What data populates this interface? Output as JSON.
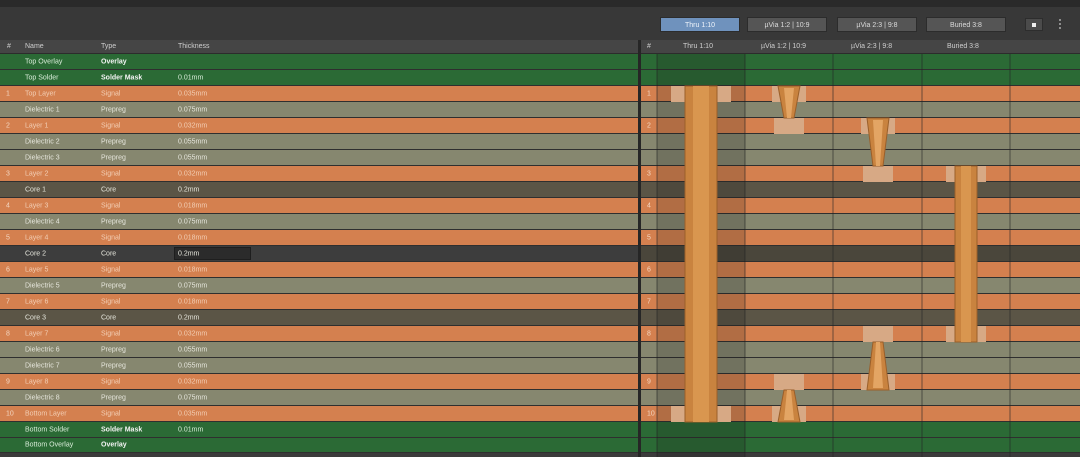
{
  "toolbar": {
    "via_tabs": [
      "Thru 1:10",
      "µVia 1:2 | 10:9",
      "µVia 2:3 | 9:8",
      "Buried 3:8"
    ],
    "active_tab": 0,
    "add_icon": "plus-icon",
    "menu_icon": "vertical-dots-icon"
  },
  "table": {
    "headers": [
      "#",
      "Name",
      "Type",
      "Thickness"
    ],
    "rows": [
      {
        "idx": "",
        "name": "Top Overlay",
        "type": "Overlay",
        "thickness": "",
        "kind": "mask"
      },
      {
        "idx": "",
        "name": "Top Solder",
        "type": "Solder Mask",
        "thickness": "0.01mm",
        "kind": "mask"
      },
      {
        "idx": "1",
        "name": "Top Layer",
        "type": "Signal",
        "thickness": "0.035mm",
        "kind": "signal"
      },
      {
        "idx": "",
        "name": "Dielectric 1",
        "type": "Prepreg",
        "thickness": "0.075mm",
        "kind": "prepreg"
      },
      {
        "idx": "2",
        "name": "Layer 1",
        "type": "Signal",
        "thickness": "0.032mm",
        "kind": "signal"
      },
      {
        "idx": "",
        "name": "Dielectric 2",
        "type": "Prepreg",
        "thickness": "0.055mm",
        "kind": "prepreg"
      },
      {
        "idx": "",
        "name": "Dielectric 3",
        "type": "Prepreg",
        "thickness": "0.055mm",
        "kind": "prepreg"
      },
      {
        "idx": "3",
        "name": "Layer 2",
        "type": "Signal",
        "thickness": "0.032mm",
        "kind": "signal"
      },
      {
        "idx": "",
        "name": "Core 1",
        "type": "Core",
        "thickness": "0.2mm",
        "kind": "core"
      },
      {
        "idx": "4",
        "name": "Layer 3",
        "type": "Signal",
        "thickness": "0.018mm",
        "kind": "signal"
      },
      {
        "idx": "",
        "name": "Dielectric 4",
        "type": "Prepreg",
        "thickness": "0.075mm",
        "kind": "prepreg"
      },
      {
        "idx": "5",
        "name": "Layer 4",
        "type": "Signal",
        "thickness": "0.018mm",
        "kind": "signal"
      },
      {
        "idx": "",
        "name": "Core 2",
        "type": "Core",
        "thickness": "0.2mm",
        "kind": "core",
        "selected": true
      },
      {
        "idx": "6",
        "name": "Layer 5",
        "type": "Signal",
        "thickness": "0.018mm",
        "kind": "signal"
      },
      {
        "idx": "",
        "name": "Dielectric 5",
        "type": "Prepreg",
        "thickness": "0.075mm",
        "kind": "prepreg"
      },
      {
        "idx": "7",
        "name": "Layer 6",
        "type": "Signal",
        "thickness": "0.018mm",
        "kind": "signal"
      },
      {
        "idx": "",
        "name": "Core 3",
        "type": "Core",
        "thickness": "0.2mm",
        "kind": "core"
      },
      {
        "idx": "8",
        "name": "Layer 7",
        "type": "Signal",
        "thickness": "0.032mm",
        "kind": "signal"
      },
      {
        "idx": "",
        "name": "Dielectric 6",
        "type": "Prepreg",
        "thickness": "0.055mm",
        "kind": "prepreg"
      },
      {
        "idx": "",
        "name": "Dielectric 7",
        "type": "Prepreg",
        "thickness": "0.055mm",
        "kind": "prepreg"
      },
      {
        "idx": "9",
        "name": "Layer 8",
        "type": "Signal",
        "thickness": "0.032mm",
        "kind": "signal"
      },
      {
        "idx": "",
        "name": "Dielectric 8",
        "type": "Prepreg",
        "thickness": "0.075mm",
        "kind": "prepreg"
      },
      {
        "idx": "10",
        "name": "Bottom Layer",
        "type": "Signal",
        "thickness": "0.035mm",
        "kind": "signal"
      },
      {
        "idx": "",
        "name": "Bottom Solder",
        "type": "Solder Mask",
        "thickness": "0.01mm",
        "kind": "mask"
      },
      {
        "idx": "",
        "name": "Bottom Overlay",
        "type": "Overlay",
        "thickness": "",
        "kind": "mask"
      }
    ]
  },
  "via_panel": {
    "headers": [
      "#",
      "Thru 1:10",
      "µVia 1:2 | 10:9",
      "µVia 2:3 | 9:8",
      "Buried 3:8"
    ]
  },
  "colors": {
    "signal": "#d4804f",
    "prepreg": "#86876f",
    "core": "#5b5546",
    "mask": "#2b6a35",
    "copper": "#c9833f",
    "pad": "#d7a985",
    "active_tab": "#6f92bd"
  }
}
